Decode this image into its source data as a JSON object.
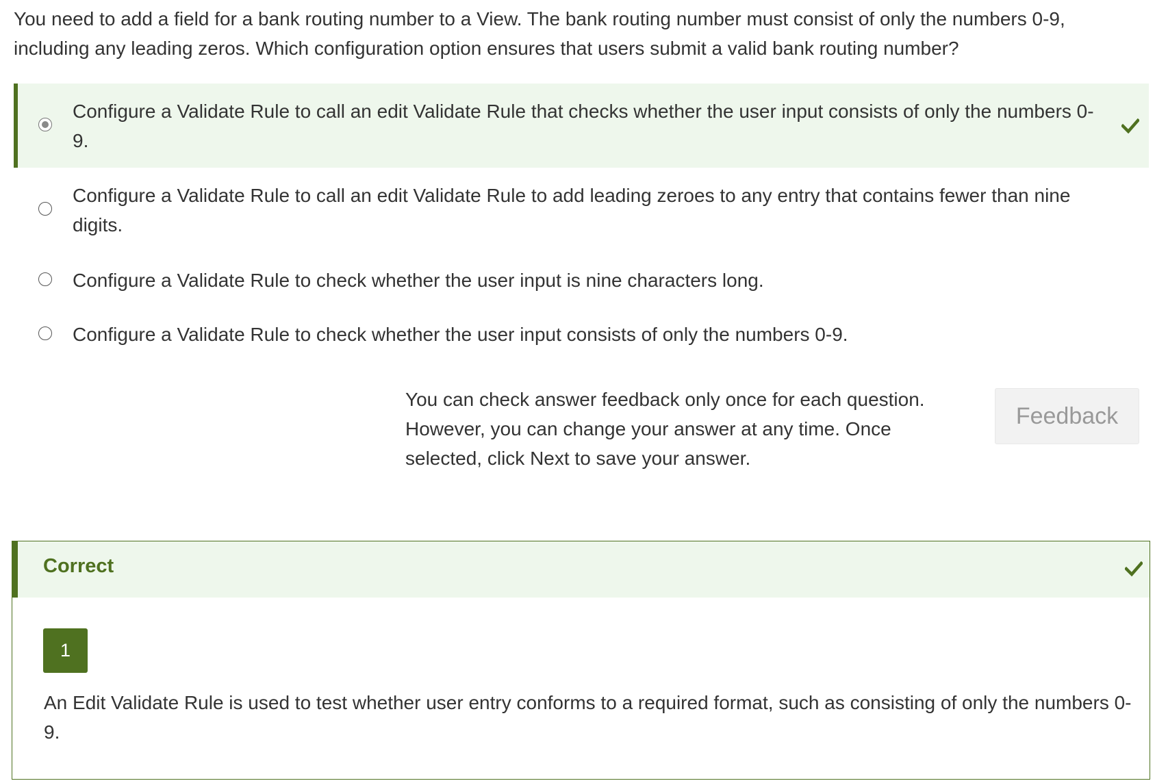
{
  "question": {
    "text": "You need to add a field for a bank routing number to a View. The bank routing number must consist of only the numbers 0-9, including any leading zeros. Which configuration option ensures that users submit a valid bank routing number?"
  },
  "options": [
    {
      "label": "Configure a Validate Rule to call an edit Validate Rule that checks whether the user input consists of only the numbers 0-9.",
      "selected": true,
      "status_icon": "check-icon"
    },
    {
      "label": "Configure a Validate Rule to call an edit Validate Rule to add leading zeroes to any entry that contains fewer than nine digits.",
      "selected": false
    },
    {
      "label": "Configure a Validate Rule to check whether the user input is nine characters long.",
      "selected": false
    },
    {
      "label": "Configure a Validate Rule to check whether the user input consists of only the numbers 0-9.",
      "selected": false
    }
  ],
  "feedback": {
    "note": "You can check answer feedback only once for each question. However, you can change your answer at any time. Once selected, click Next to save your answer.",
    "button_label": "Feedback"
  },
  "result": {
    "title": "Correct",
    "badge": "1",
    "explanation": "An Edit Validate Rule is used to test whether user entry conforms to a required format, such as consisting of only the numbers 0-9.",
    "icon": "check-icon"
  },
  "colors": {
    "accent_green": "#4f7120",
    "selected_bg": "#eef7ec",
    "text": "#333333",
    "button_bg": "#f2f2f2",
    "button_text": "#999999"
  }
}
